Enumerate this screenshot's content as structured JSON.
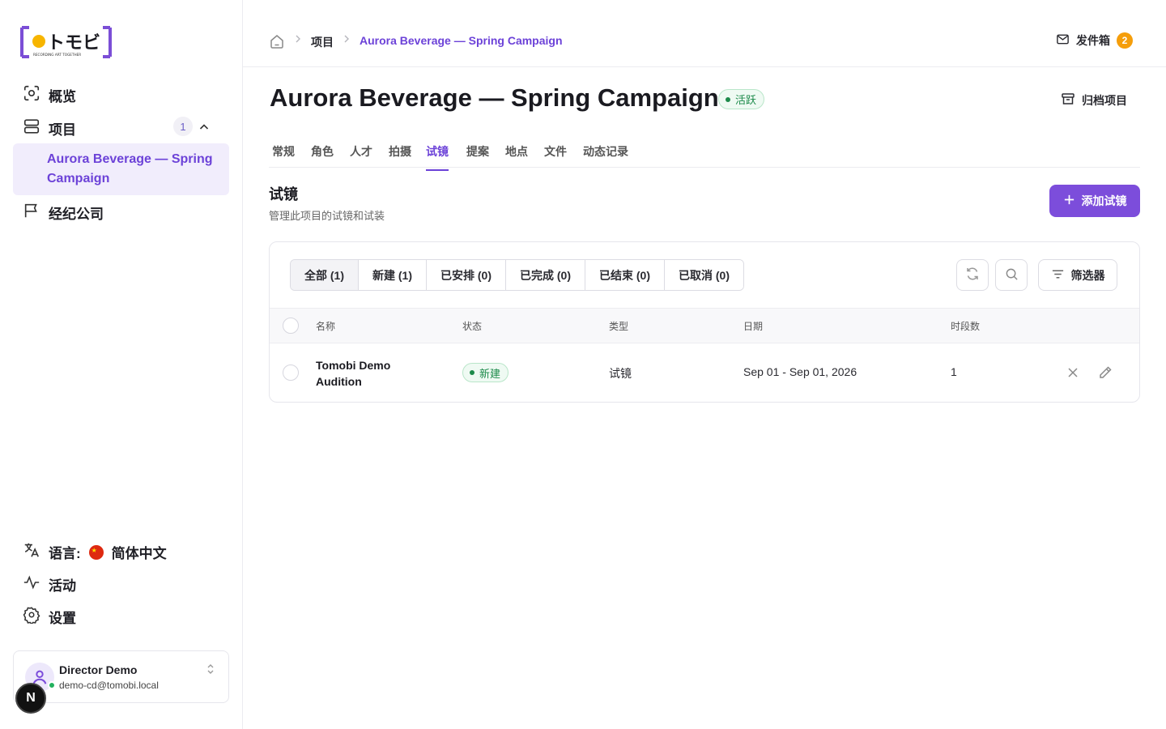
{
  "sidebar": {
    "logo_text": "トモビ",
    "logo_tagline": "RECORDING ART TOGETHER",
    "nav": {
      "overview": "概览",
      "projects": "项目",
      "projects_count": "1",
      "project_sub": "Aurora Beverage — Spring Campaign",
      "agencies": "经纪公司"
    },
    "bottom": {
      "language_label": "语言:",
      "language_value": "简体中文",
      "activity": "活动",
      "settings": "设置"
    },
    "user": {
      "name": "Director Demo",
      "email": "demo-cd@tomobi.local",
      "badge": "N"
    }
  },
  "header": {
    "breadcrumb": [
      "项目",
      "Aurora Beverage — Spring Campaign"
    ],
    "outbox_label": "发件箱",
    "outbox_count": "2"
  },
  "project": {
    "title": "Aurora Beverage — Spring Campaign",
    "status": "活跃",
    "archive_label": "归档项目"
  },
  "tabs": [
    "常规",
    "角色",
    "人才",
    "拍摄",
    "试镜",
    "提案",
    "地点",
    "文件",
    "动态记录"
  ],
  "active_tab": "试镜",
  "section": {
    "title": "试镜",
    "subtitle": "管理此项目的试镜和试装",
    "add_button": "添加试镜"
  },
  "filters": {
    "segments": [
      "全部 (1)",
      "新建 (1)",
      "已安排 (0)",
      "已完成 (0)",
      "已结束 (0)",
      "已取消 (0)"
    ],
    "filter_button": "筛选器"
  },
  "table": {
    "columns": [
      "名称",
      "状态",
      "类型",
      "日期",
      "时段数"
    ],
    "rows": [
      {
        "name": "Tomobi Demo Audition",
        "status": "新建",
        "type": "试镜",
        "date": "Sep 01 - Sep 01, 2026",
        "slots": "1"
      }
    ]
  },
  "colors": {
    "accent": "#6c42d8",
    "primary_button": "#7c4ddb",
    "success": "#1c8a4a",
    "badge": "#f59e0b"
  }
}
